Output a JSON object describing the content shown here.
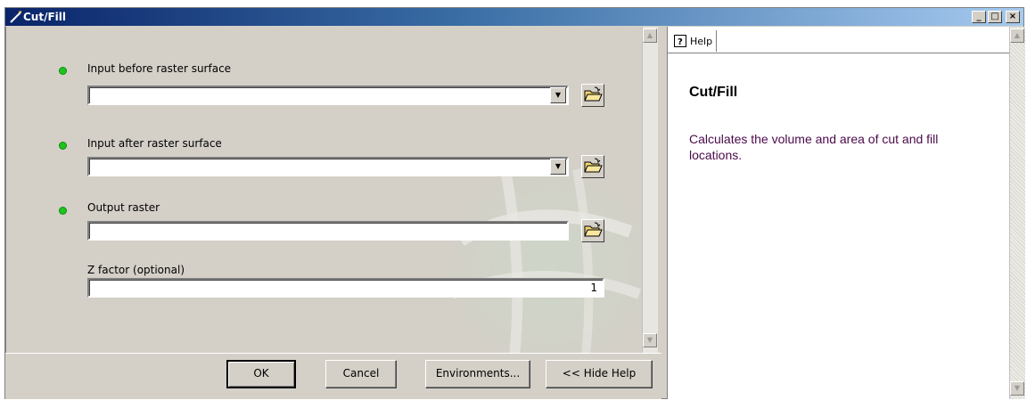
{
  "window": {
    "title": "Cut/Fill",
    "controls": {
      "minimize": "_",
      "maximize": "□",
      "close": "×"
    }
  },
  "form": {
    "input_before": {
      "label": "Input before raster surface",
      "value": "",
      "required": true
    },
    "input_after": {
      "label": "Input after raster surface",
      "value": "",
      "required": true
    },
    "output_raster": {
      "label": "Output raster",
      "value": "",
      "required": true
    },
    "z_factor": {
      "label": "Z factor (optional)",
      "value": "1",
      "required": false
    }
  },
  "buttons": {
    "ok": "OK",
    "cancel": "Cancel",
    "environments": "Environments...",
    "hide_help": "<< Hide Help"
  },
  "help": {
    "tab_label": "Help",
    "title": "Cut/Fill",
    "description": "Calculates the volume and area of cut and fill locations."
  },
  "icons": {
    "title": "pencil-icon",
    "browse": "open-folder-icon",
    "dropdown": "dropdown-arrow-icon",
    "help_tab": "help-question-icon",
    "required": "green-dot-icon"
  },
  "colors": {
    "required_dot": "#1fc41f",
    "titlebar_start": "#0a246a",
    "titlebar_end": "#a6caf0",
    "help_text": "#4b0a4b"
  }
}
